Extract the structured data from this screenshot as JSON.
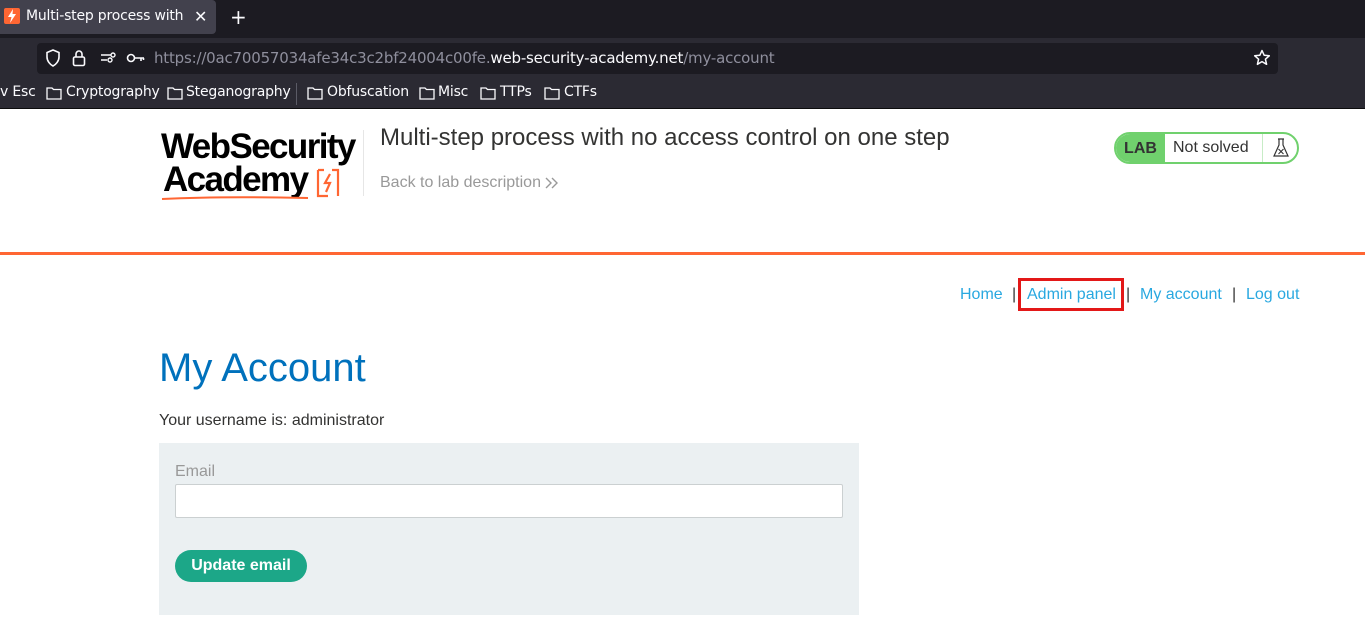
{
  "browser": {
    "tab_title": "Multi-step process with no access control on one step",
    "new_tab_icon": "plus-icon",
    "url_prefix": "https://0ac70057034afe34c3c2bf24004c00fe.",
    "url_domain": "web-security-academy.net",
    "url_path": "/my-account",
    "bookmarks": [
      {
        "label": "v Esc",
        "folder": false
      },
      {
        "label": "Cryptography",
        "folder": true
      },
      {
        "label": "Steganography",
        "folder": true
      },
      {
        "label": "Obfuscation",
        "folder": true
      },
      {
        "label": "Misc",
        "folder": true
      },
      {
        "label": "TTPs",
        "folder": true
      },
      {
        "label": "CTFs",
        "folder": true
      }
    ]
  },
  "header": {
    "logo_line1": "WebSecurity",
    "logo_line2": "Academy",
    "lab_title": "Multi-step process with no access control on one step",
    "back_link": "Back to lab description",
    "lab_badge": "LAB",
    "lab_state": "Not solved",
    "brand_color": "#ff6633",
    "solved_color": "#70d16d"
  },
  "nav": {
    "home": "Home",
    "admin_panel": "Admin panel",
    "my_account": "My account",
    "log_out": "Log out",
    "separator": "|",
    "link_color": "#29a8e0"
  },
  "main": {
    "title": "My Account",
    "username_line": "Your username is: administrator",
    "email_label": "Email",
    "email_value": "",
    "update_button": "Update email",
    "button_color": "#1ca788"
  }
}
